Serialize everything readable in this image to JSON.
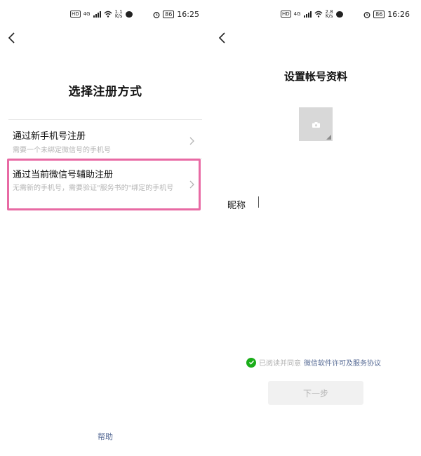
{
  "left": {
    "status": {
      "chip": "HD",
      "net": "4G",
      "speed_top": "1.1",
      "speed_bottom": "K/s",
      "battery": "86",
      "time": "16:25"
    },
    "title": "选择注册方式",
    "options": [
      {
        "title": "通过新手机号注册",
        "subtitle": "需要一个未绑定微信号的手机号"
      },
      {
        "title": "通过当前微信号辅助注册",
        "subtitle": "无需新的手机号，需要验证\"服务书的\"绑定的手机号"
      }
    ],
    "help": "帮助"
  },
  "right": {
    "status": {
      "chip": "HD",
      "net": "4G",
      "speed_top": "2.8",
      "speed_bottom": "K/s",
      "battery": "86",
      "time": "16:26"
    },
    "title": "设置帐号资料",
    "nickname_label": "昵称",
    "nickname_value": "",
    "agree_text": "已阅读并同意",
    "agree_link": "微信软件许可及服务协议",
    "next_button": "下一步"
  },
  "colors": {
    "highlight": "#e86aa4",
    "link": "#576b95",
    "check": "#1aad19"
  },
  "icons": [
    "back-arrow-icon",
    "chevron-right-icon",
    "camera-icon",
    "check-circle-icon",
    "wifi-icon",
    "signal-icon",
    "alarm-icon",
    "battery-icon",
    "message-bubble-icon"
  ]
}
